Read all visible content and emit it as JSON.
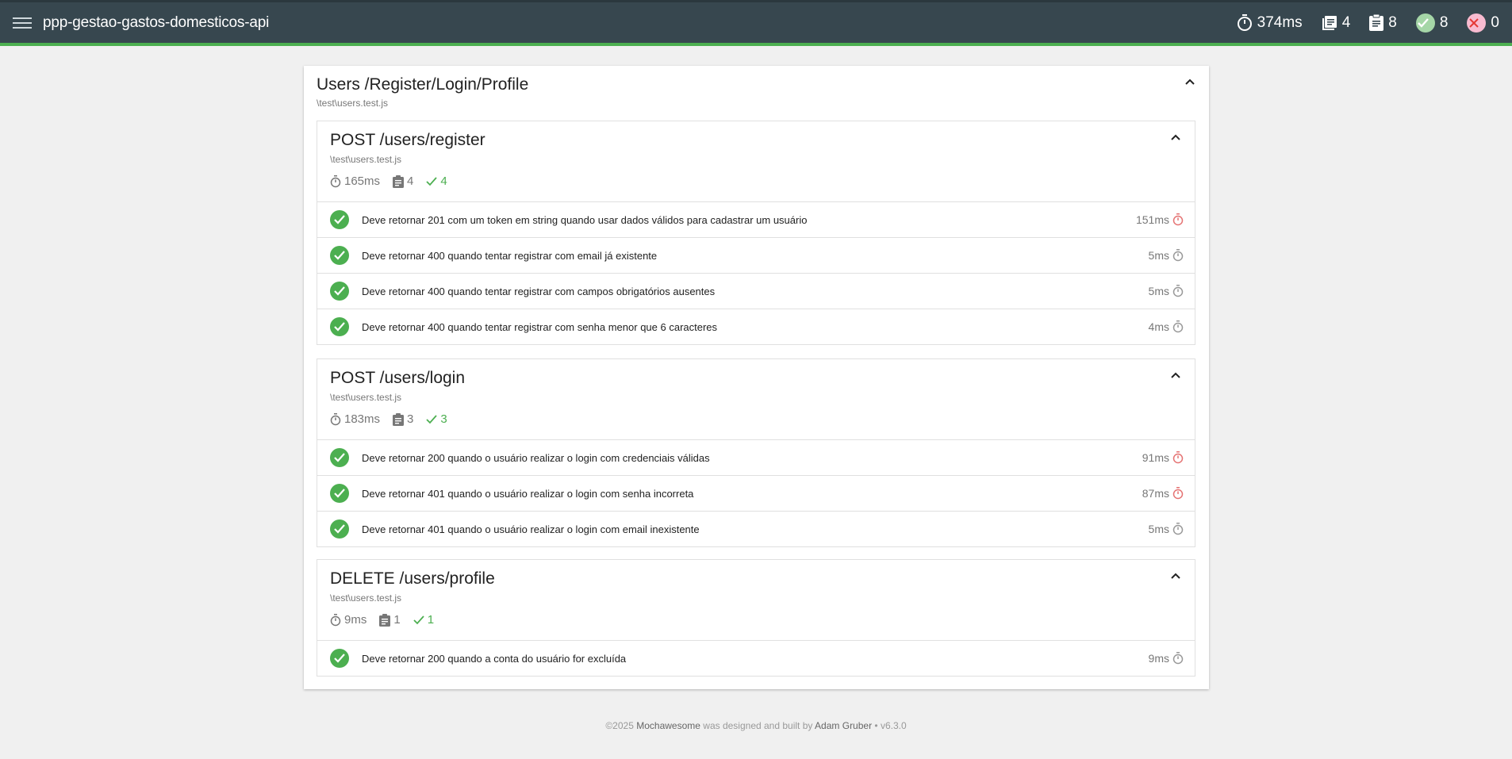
{
  "header": {
    "title": "ppp-gestao-gastos-domesticos-api",
    "duration": "374ms",
    "suites": "4",
    "tests": "8",
    "passes": "8",
    "failures": "0"
  },
  "suite": {
    "title": "Users /Register/Login/Profile",
    "file": "\\test\\users.test.js",
    "subsuites": [
      {
        "title": "POST /users/register",
        "file": "\\test\\users.test.js",
        "duration": "165ms",
        "tests": "4",
        "passes": "4",
        "items": [
          {
            "name": "Deve retornar 201 com um token em string quando usar dados válidos para cadastrar um usuário",
            "duration": "151ms",
            "slow": true
          },
          {
            "name": "Deve retornar 400 quando tentar registrar com email já existente",
            "duration": "5ms",
            "slow": false
          },
          {
            "name": "Deve retornar 400 quando tentar registrar com campos obrigatórios ausentes",
            "duration": "5ms",
            "slow": false
          },
          {
            "name": "Deve retornar 400 quando tentar registrar com senha menor que 6 caracteres",
            "duration": "4ms",
            "slow": false
          }
        ]
      },
      {
        "title": "POST /users/login",
        "file": "\\test\\users.test.js",
        "duration": "183ms",
        "tests": "3",
        "passes": "3",
        "items": [
          {
            "name": "Deve retornar 200 quando o usuário realizar o login com credenciais válidas",
            "duration": "91ms",
            "slow": true
          },
          {
            "name": "Deve retornar 401 quando o usuário realizar o login com senha incorreta",
            "duration": "87ms",
            "slow": true
          },
          {
            "name": "Deve retornar 401 quando o usuário realizar o login com email inexistente",
            "duration": "5ms",
            "slow": false
          }
        ]
      },
      {
        "title": "DELETE /users/profile",
        "file": "\\test\\users.test.js",
        "duration": "9ms",
        "tests": "1",
        "passes": "1",
        "items": [
          {
            "name": "Deve retornar 200 quando a conta do usuário for excluída",
            "duration": "9ms",
            "slow": false
          }
        ]
      }
    ]
  },
  "footer": {
    "copyright": "©2025",
    "brand": "Mochawesome",
    "mid": "was designed and built by",
    "author": "Adam Gruber",
    "version": "• v6.3.0"
  },
  "colors": {
    "topbar": "#37474f",
    "accent": "#4caf50",
    "slow": "#e57373",
    "muted": "#777777"
  }
}
